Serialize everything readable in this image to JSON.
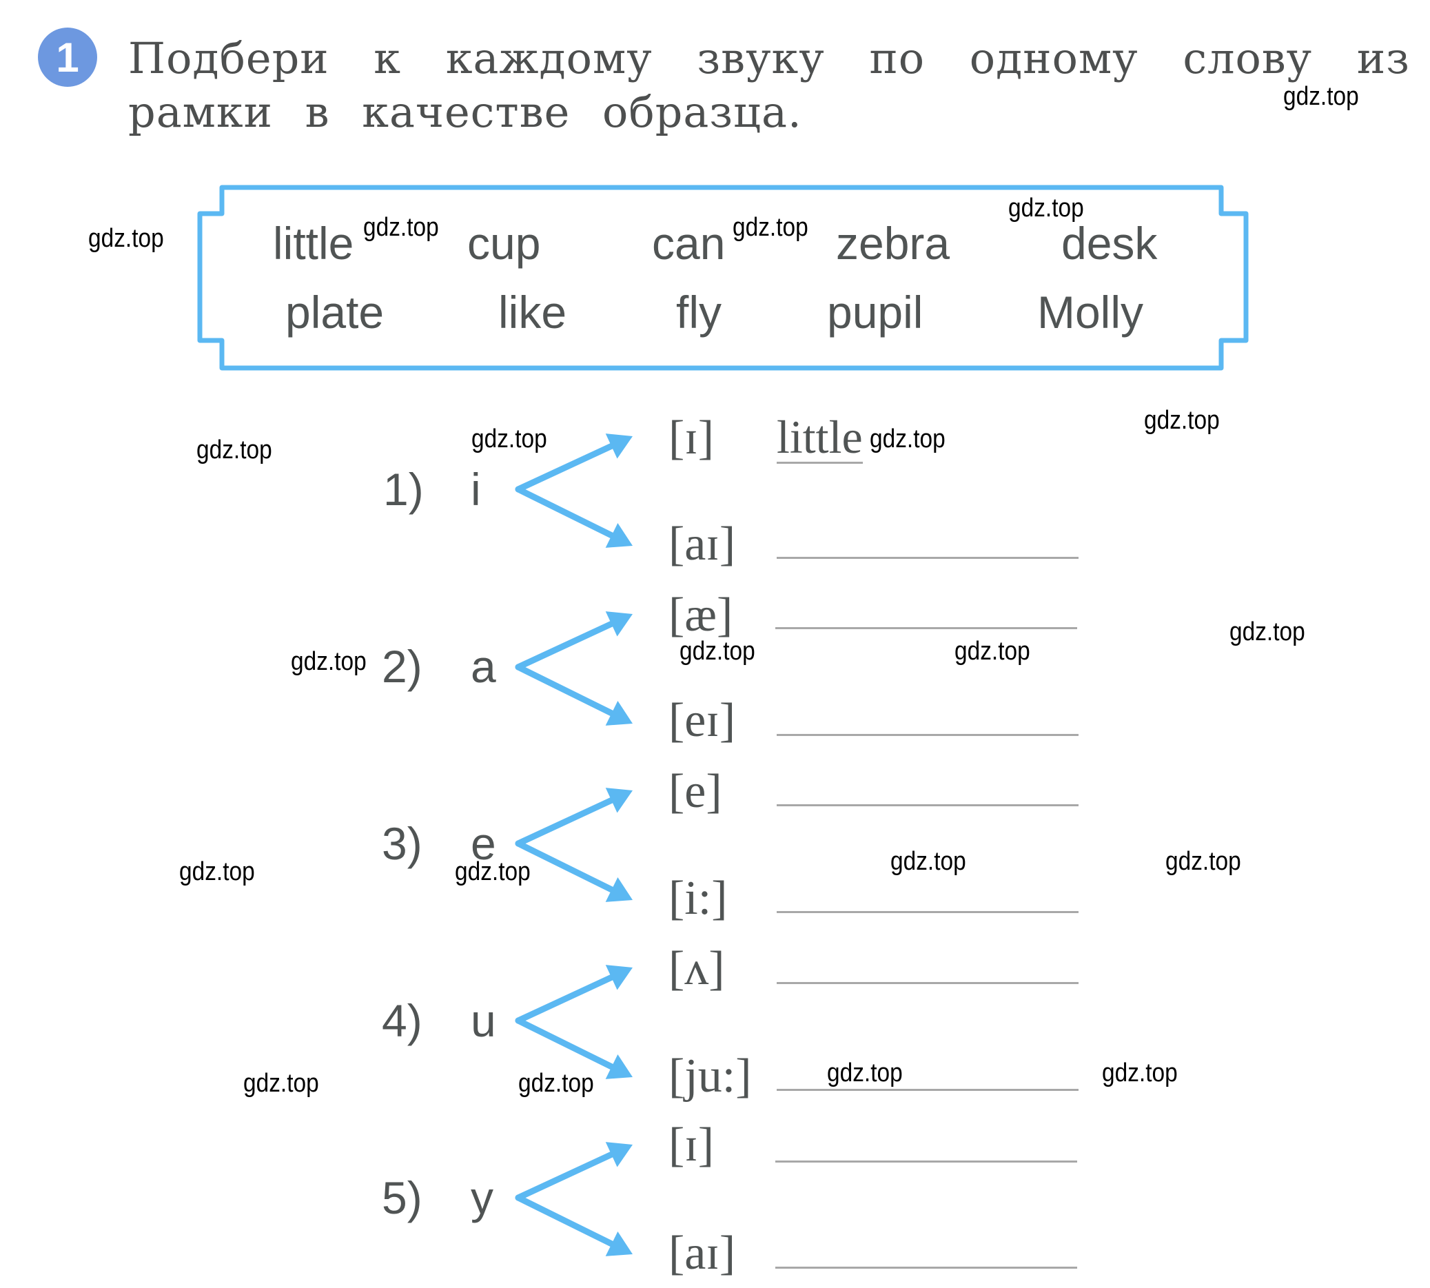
{
  "exercise": {
    "number": "1",
    "title_line1": "Подбери к каждому звуку по одному слову из",
    "title_line2": "рамки в качестве образца."
  },
  "word_box": {
    "row1": [
      "little",
      "cup",
      "can",
      "zebra",
      "desk"
    ],
    "row2": [
      "plate",
      "like",
      "fly",
      "pupil",
      "Molly"
    ]
  },
  "accent_color": "#5bb8f2",
  "rows": [
    {
      "label": "1)",
      "letter": "i",
      "sounds": [
        {
          "ipa": "[ɪ]",
          "answer": "little"
        },
        {
          "ipa": "[aɪ]",
          "answer": ""
        }
      ]
    },
    {
      "label": "2)",
      "letter": "a",
      "sounds": [
        {
          "ipa": "[æ]",
          "answer": ""
        },
        {
          "ipa": "[eɪ]",
          "answer": ""
        }
      ]
    },
    {
      "label": "3)",
      "letter": "e",
      "sounds": [
        {
          "ipa": "[e]",
          "answer": ""
        },
        {
          "ipa": "[i:]",
          "answer": ""
        }
      ]
    },
    {
      "label": "4)",
      "letter": "u",
      "sounds": [
        {
          "ipa": "[ʌ]",
          "answer": ""
        },
        {
          "ipa": "[ju:]",
          "answer": ""
        }
      ]
    },
    {
      "label": "5)",
      "letter": "y",
      "sounds": [
        {
          "ipa": "[ɪ]",
          "answer": ""
        },
        {
          "ipa": "[aɪ]",
          "answer": ""
        }
      ]
    }
  ],
  "watermark": "gdz.top"
}
